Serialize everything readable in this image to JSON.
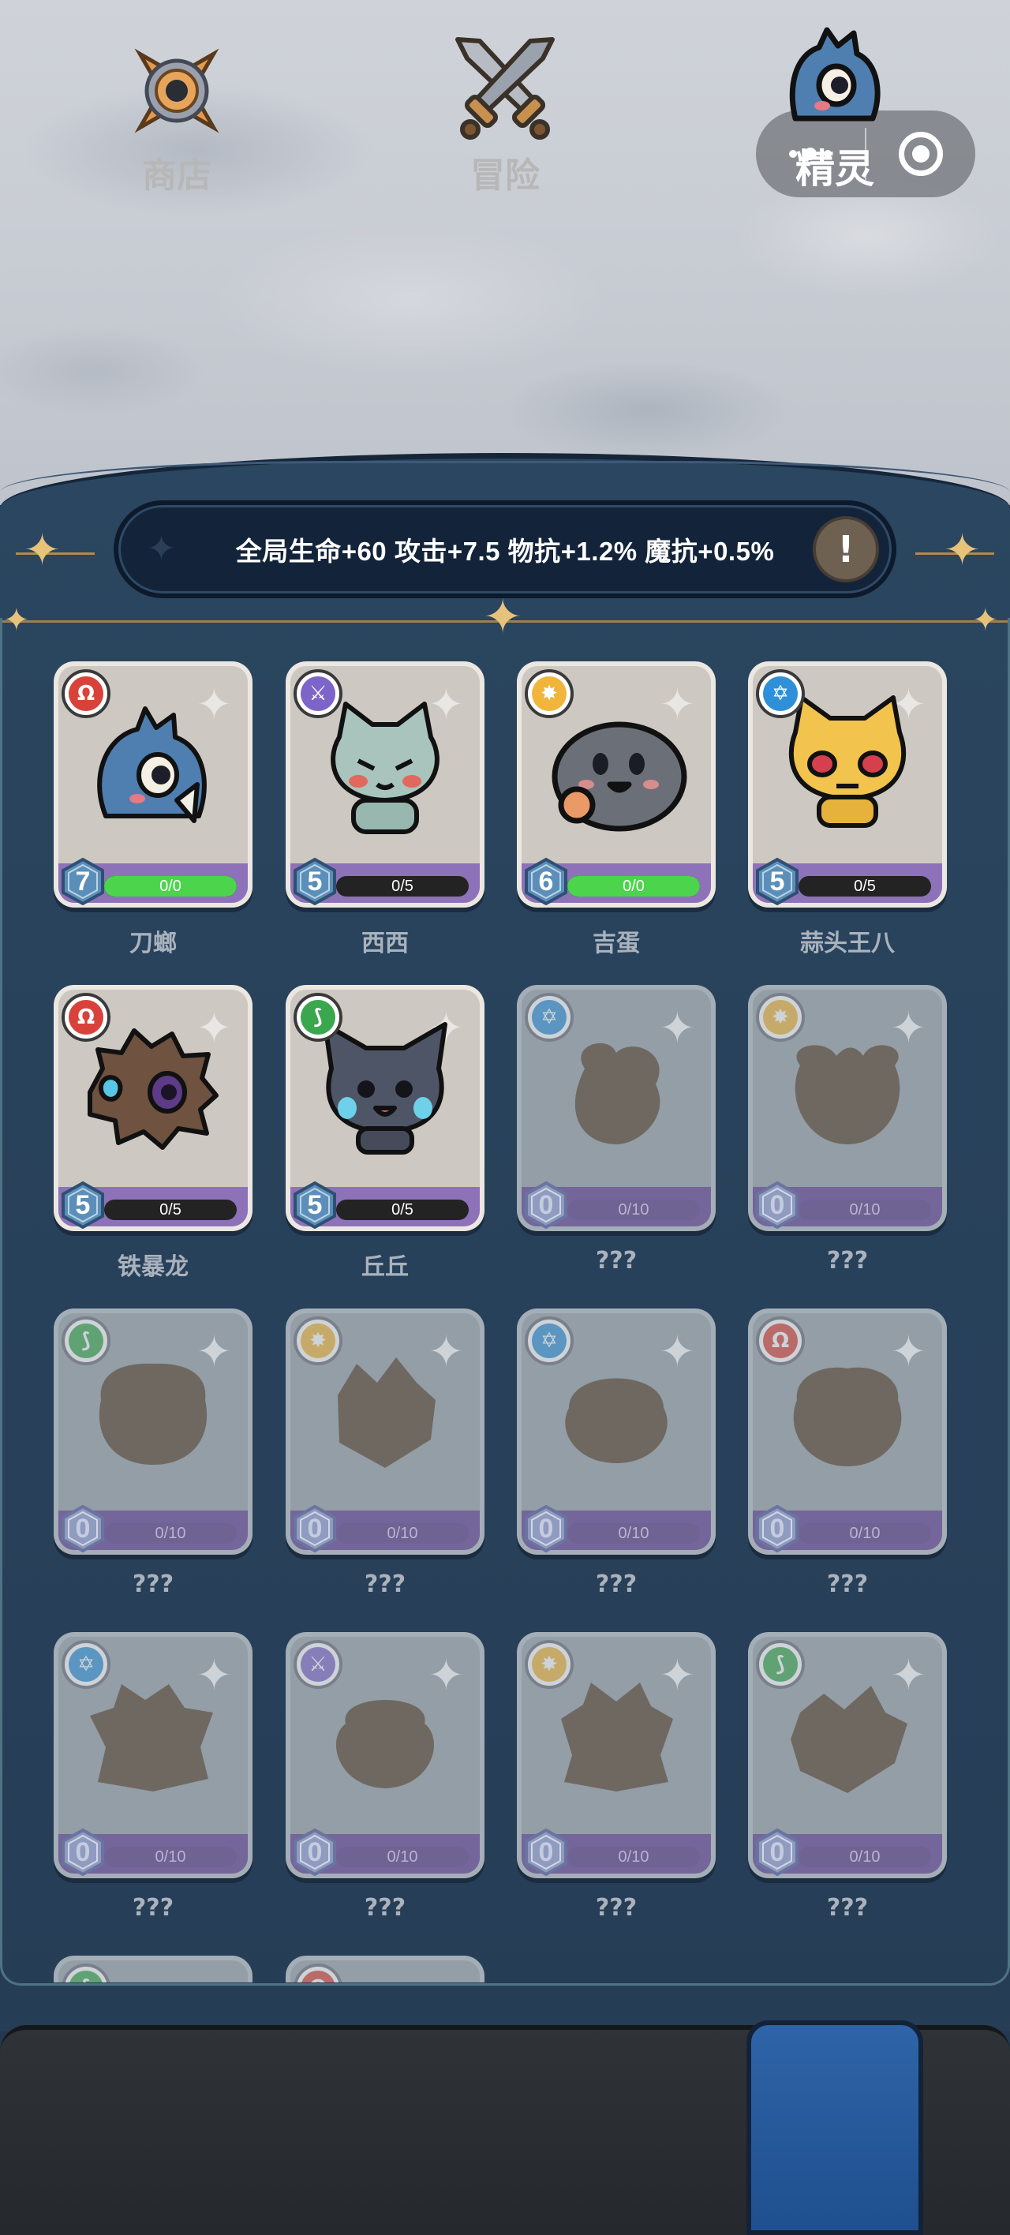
{
  "header": {
    "more_icon": "more-dots-icon",
    "close_icon": "target-circle-icon"
  },
  "bonus": {
    "text": "全局生命+60 攻击+7.5 物抗+1.2% 魔抗+0.5%",
    "info_label": "!"
  },
  "colors": {
    "element_red": "#d8423a",
    "element_purple": "#7d64c8",
    "element_yellow": "#f0b53a",
    "element_blue": "#2f8fd8",
    "element_green": "#3aa64d",
    "progress_green": "#4cd44c",
    "nav_active": "#2e64a8"
  },
  "spirits": [
    {
      "name": "刀螂",
      "level": "7",
      "progress": "0/0",
      "fill": 1.0,
      "element": "red",
      "unlocked": true,
      "art": "blue-dragon"
    },
    {
      "name": "西西",
      "level": "5",
      "progress": "0/5",
      "fill": 0.0,
      "element": "purple",
      "unlocked": true,
      "art": "gray-cat"
    },
    {
      "name": "吉蛋",
      "level": "6",
      "progress": "0/0",
      "fill": 1.0,
      "element": "yellow",
      "unlocked": true,
      "art": "gray-blob"
    },
    {
      "name": "蒜头王八",
      "level": "5",
      "progress": "0/5",
      "fill": 0.0,
      "element": "blue",
      "unlocked": true,
      "art": "yellow-cat"
    },
    {
      "name": "铁暴龙",
      "level": "5",
      "progress": "0/5",
      "fill": 0.0,
      "element": "red",
      "unlocked": true,
      "art": "brown-lion"
    },
    {
      "name": "丘丘",
      "level": "5",
      "progress": "0/5",
      "fill": 0.0,
      "element": "green",
      "unlocked": true,
      "art": "dark-cat"
    },
    {
      "name": "???",
      "level": "0",
      "progress": "0/10",
      "fill": 0.0,
      "element": "blue",
      "unlocked": false
    },
    {
      "name": "???",
      "level": "0",
      "progress": "0/10",
      "fill": 0.0,
      "element": "yellow",
      "unlocked": false
    },
    {
      "name": "???",
      "level": "0",
      "progress": "0/10",
      "fill": 0.0,
      "element": "green",
      "unlocked": false
    },
    {
      "name": "???",
      "level": "0",
      "progress": "0/10",
      "fill": 0.0,
      "element": "yellow",
      "unlocked": false
    },
    {
      "name": "???",
      "level": "0",
      "progress": "0/10",
      "fill": 0.0,
      "element": "blue",
      "unlocked": false
    },
    {
      "name": "???",
      "level": "0",
      "progress": "0/10",
      "fill": 0.0,
      "element": "red",
      "unlocked": false
    },
    {
      "name": "???",
      "level": "0",
      "progress": "0/10",
      "fill": 0.0,
      "element": "blue",
      "unlocked": false
    },
    {
      "name": "???",
      "level": "0",
      "progress": "0/10",
      "fill": 0.0,
      "element": "purple",
      "unlocked": false
    },
    {
      "name": "???",
      "level": "0",
      "progress": "0/10",
      "fill": 0.0,
      "element": "yellow",
      "unlocked": false
    },
    {
      "name": "???",
      "level": "0",
      "progress": "0/10",
      "fill": 0.0,
      "element": "green",
      "unlocked": false
    },
    {
      "name": "",
      "level": "",
      "progress": "",
      "fill": 0.0,
      "element": "green",
      "unlocked": false
    },
    {
      "name": "",
      "level": "",
      "progress": "",
      "fill": 0.0,
      "element": "red",
      "unlocked": false
    }
  ],
  "nav": {
    "shop": {
      "label": "商店",
      "icon": "shop-compass-icon"
    },
    "adventure": {
      "label": "冒险",
      "icon": "crossed-swords-icon"
    },
    "spirit": {
      "label": "精灵",
      "icon": "spirit-icon",
      "active": true
    }
  }
}
